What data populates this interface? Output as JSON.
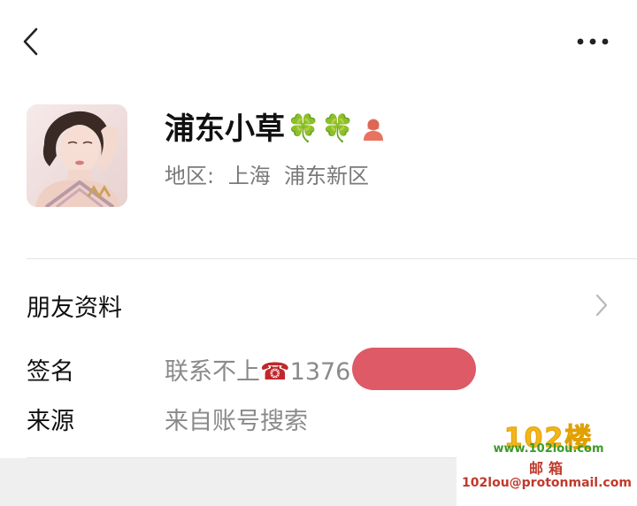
{
  "header": {
    "back_icon": "chevron-left-icon",
    "more_icon": "more-dots-icon"
  },
  "profile": {
    "avatar": "profile-photo",
    "nickname": "浦东小草",
    "nickname_emojis": [
      "🍀",
      "🍀"
    ],
    "gender_icon": "female-person-icon",
    "gender_color": "#e8735e",
    "region_label": "地区:",
    "region_value": "上海  浦东新区"
  },
  "rows": {
    "friend_info": {
      "label": "朋友资料",
      "icon": "chevron-right-icon"
    },
    "signature": {
      "label": "签名",
      "text": "联系不上",
      "phone_icon": "☎",
      "phone_visible": "1376",
      "redaction_color": "#dd5a66"
    },
    "source": {
      "label": "来源",
      "value": "来自账号搜索"
    }
  },
  "watermark": {
    "logo": "102楼",
    "site": "www.102lou.com",
    "mail_title": "邮箱",
    "email": "102lou@protonmail.com"
  }
}
